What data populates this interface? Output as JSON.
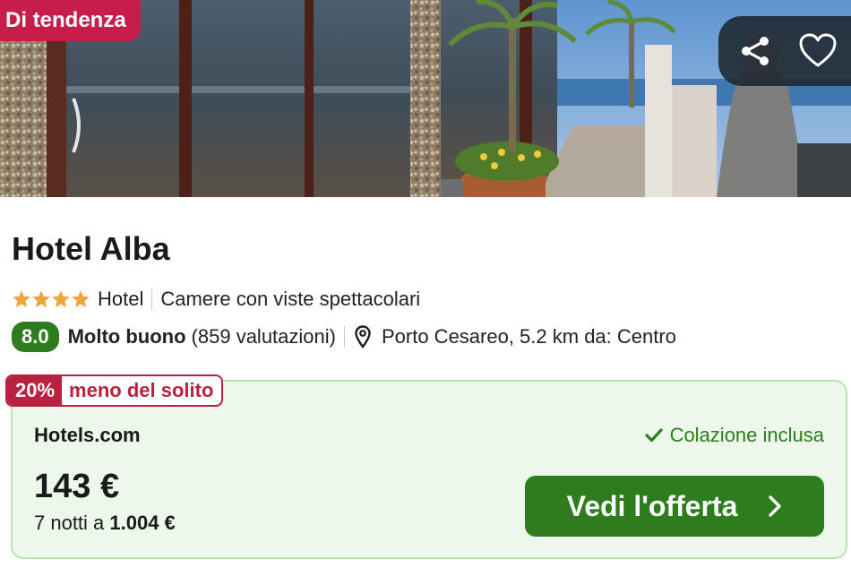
{
  "hero": {
    "badge": "Di tendenza",
    "share_icon": "share-icon",
    "favorite_icon": "heart-icon"
  },
  "hotel": {
    "name": "Hotel Alba",
    "stars": 4,
    "type": "Hotel",
    "feature": "Camere con viste spettacolari"
  },
  "rating": {
    "score": "8.0",
    "label": "Molto buono",
    "count": "(859 valutazioni)",
    "location": "Porto Cesareo, 5.2 km da: Centro"
  },
  "deal": {
    "discount_pct": "20%",
    "discount_label": "meno del solito",
    "provider": "Hotels.com",
    "included": "Colazione inclusa",
    "price": "143 €",
    "nights_prefix": "7 notti a ",
    "total": "1.004 €",
    "cta_label": "Vedi l'offerta"
  },
  "colors": {
    "brand_green": "#2d7d1f",
    "badge_red": "#c71d4b",
    "discount_red": "#b8213f",
    "star_orange": "#f0a43a",
    "card_bg": "#ecf8ea"
  }
}
